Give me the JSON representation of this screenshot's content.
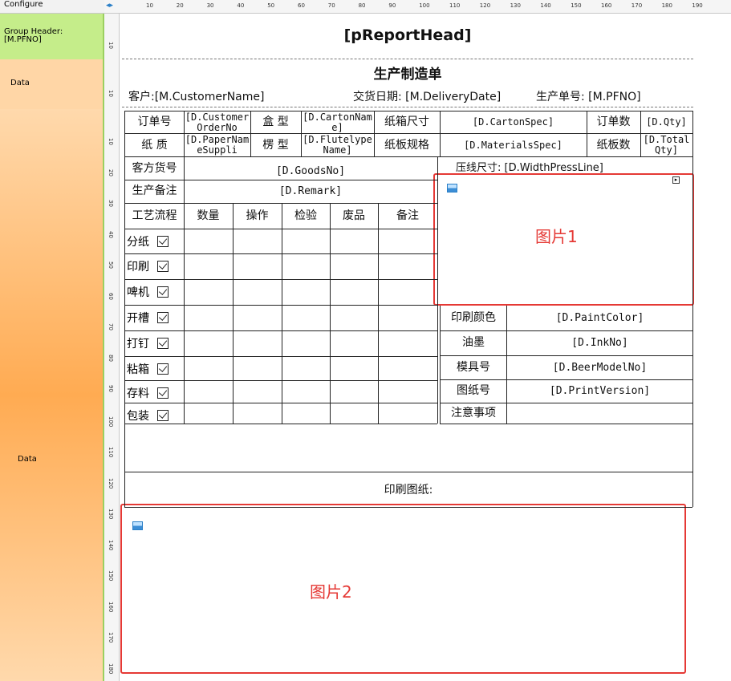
{
  "left_panel": {
    "top_label": "Configure",
    "group_header": [
      "Group Header:",
      "[M.PFNO]"
    ],
    "data_band_1": "Data",
    "data_band_2": "Data"
  },
  "ruler": {
    "h_ticks": [
      "10",
      "20",
      "30",
      "40",
      "50",
      "60",
      "70",
      "80",
      "90",
      "100",
      "110",
      "120",
      "130",
      "140",
      "150",
      "160",
      "170",
      "180",
      "190"
    ],
    "v_ticks_a": [
      "10"
    ],
    "v_ticks_b": [
      "10"
    ],
    "v_ticks_c": [
      "10",
      "20",
      "30",
      "40",
      "50",
      "60",
      "70",
      "80",
      "90",
      "100",
      "110",
      "120",
      "130",
      "140",
      "150",
      "160",
      "170",
      "180"
    ]
  },
  "report": {
    "head": "[pReportHead]",
    "title": "生产制造单",
    "customer": "客户:[M.CustomerName]",
    "delivery": "交货日期: [M.DeliveryDate]",
    "pfno": "生产单号: [M.PFNO]",
    "row1": [
      "订单号",
      "[D.CustomerOrderNo",
      "盒 型",
      "[D.CartonName]",
      "纸箱尺寸",
      "[D.CartonSpec]",
      "订单数",
      "[D.Qty]"
    ],
    "row2": [
      "纸 质",
      "[D.PaperNameSuppli",
      "楞 型",
      "[D.FlutelypeName]",
      "纸板规格",
      "[D.MaterialsSpec]",
      "纸板数",
      "[D.TotalQty]"
    ],
    "goods_label": "客方货号",
    "goods_value": "[D.GoodsNo]",
    "press_line": "压线尺寸: [D.WidthPressLine]",
    "remark_label": "生产备注",
    "remark_value": "[D.Remark]",
    "process_headers": [
      "工艺流程",
      "数量",
      "操作",
      "检验",
      "废品",
      "备注"
    ],
    "process_steps": [
      "分纸",
      "印刷",
      "啤机",
      "开槽",
      "打钉",
      "粘箱",
      "存料",
      "包装"
    ],
    "side_fields": [
      {
        "label": "印刷颜色",
        "value": "[D.PaintColor]"
      },
      {
        "label": "油墨",
        "value": "[D.InkNo]"
      },
      {
        "label": "模具号",
        "value": "[D.BeerModelNo]"
      },
      {
        "label": "图纸号",
        "value": "[D.PrintVersion]"
      },
      {
        "label": "注意事项",
        "value": ""
      }
    ],
    "print_drawing": "印刷图纸:",
    "image1_label": "图片1",
    "image2_label": "图片2"
  }
}
